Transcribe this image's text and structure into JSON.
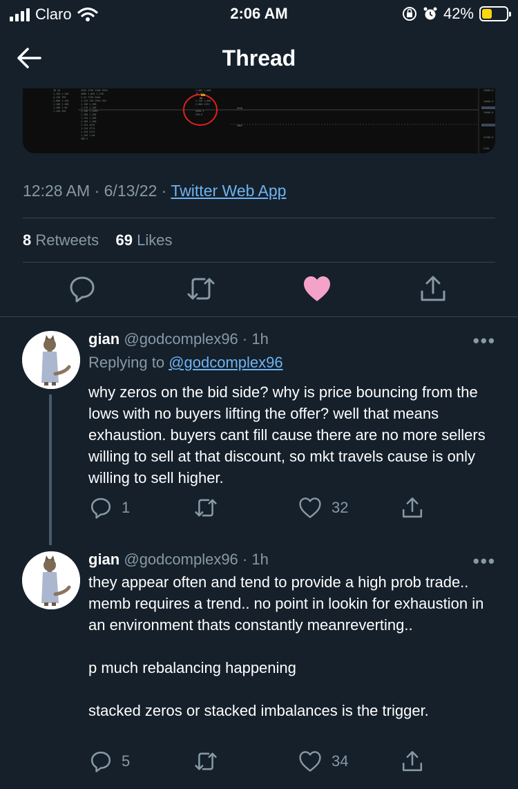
{
  "status_bar": {
    "carrier": "Claro",
    "time": "2:06 AM",
    "battery": "42%",
    "battery_level": 0.42,
    "battery_color": "#ffd60a"
  },
  "nav": {
    "title": "Thread"
  },
  "main_tweet": {
    "time": "12:28 AM",
    "date": "6/13/22",
    "source": "Twitter Web App",
    "retweets_count": "8",
    "retweets_label": "Retweets",
    "likes_count": "69",
    "likes_label": "Likes",
    "liked": true,
    "like_color": "#f4a2c8"
  },
  "replies": [
    {
      "name": "gian",
      "handle": "@godcomplex96",
      "time": "1h",
      "replying_label": "Replying to",
      "replying_handle": "@godcomplex96",
      "text": "why zeros on the bid side? why is price bouncing from the lows with no buyers lifting the offer? well that means  exhaustion. buyers cant fill cause there are no more sellers willing to sell at that discount, so mkt travels cause is only willing to sell higher.",
      "reply_count": "1",
      "like_count": "32"
    },
    {
      "name": "gian",
      "handle": "@godcomplex96",
      "time": "1h",
      "text": "they appear often and tend to provide a high prob trade.. memb requires a trend.. no point in lookin for exhaustion in an environment thats constantly meanreverting..\n\np much rebalancing happening\n\nstacked zeros or stacked imbalances is the trigger.",
      "reply_count": "5",
      "like_count": "34"
    }
  ]
}
